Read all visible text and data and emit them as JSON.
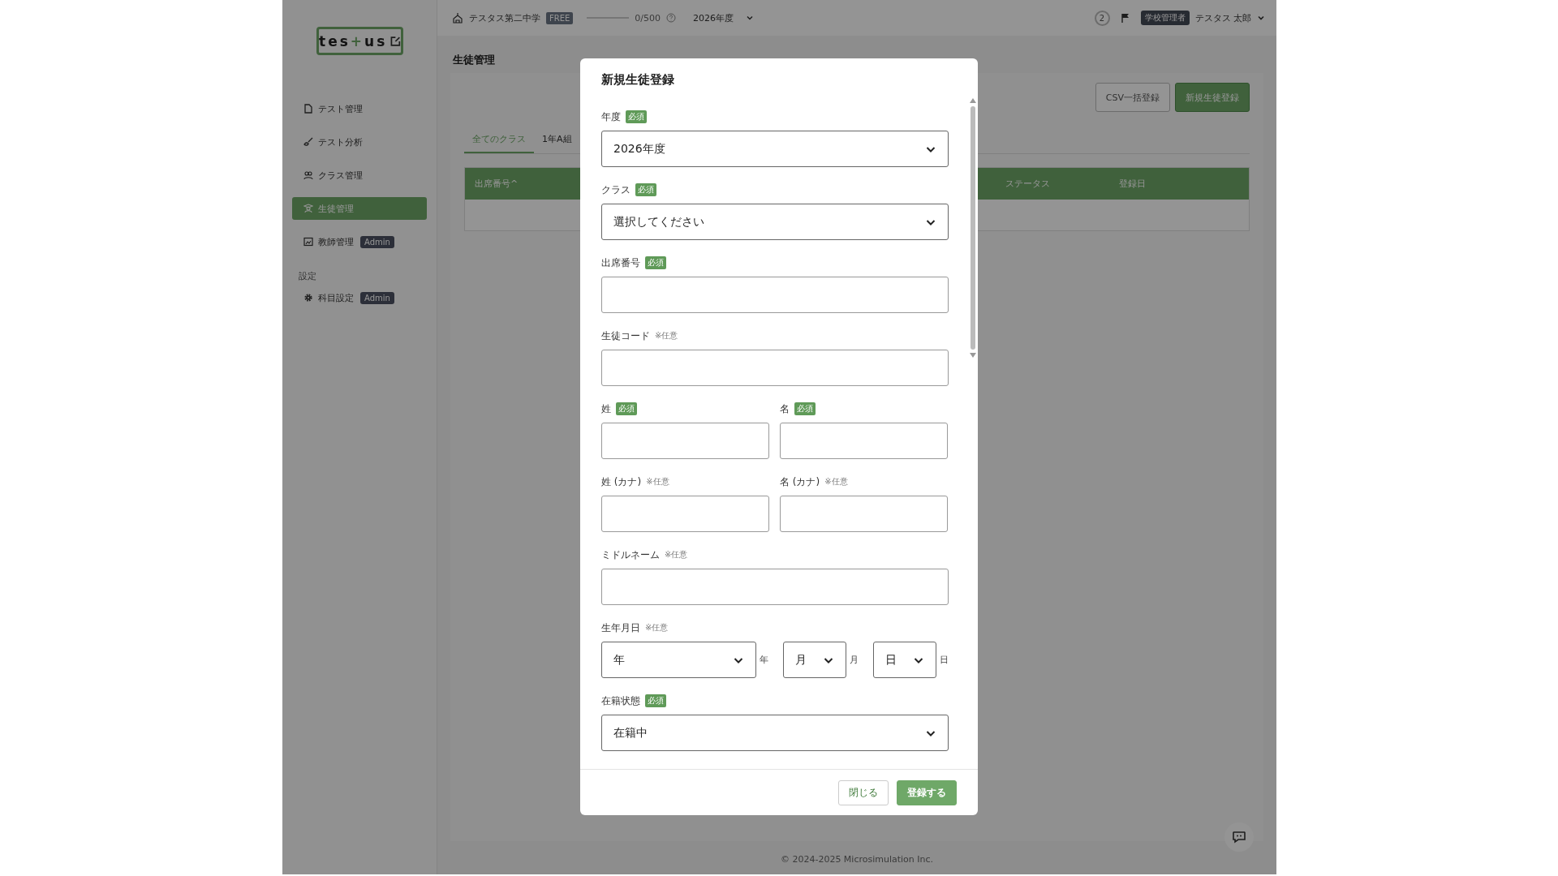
{
  "sidebar": {
    "logo": {
      "before": "tes",
      "mark": "+",
      "after": "us"
    },
    "items": [
      {
        "label": "テスト管理",
        "kind": "document",
        "selected": false
      },
      {
        "label": "テスト分析",
        "kind": "brush",
        "selected": false
      },
      {
        "label": "クラス管理",
        "kind": "people",
        "selected": false
      },
      {
        "label": "生徒管理",
        "kind": "student",
        "selected": true
      },
      {
        "label": "教師管理",
        "kind": "board",
        "selected": false,
        "badge": "Admin"
      }
    ],
    "section": "設定",
    "section_items": [
      {
        "label": "科目設定",
        "kind": "gear",
        "selected": false,
        "badge": "Admin"
      }
    ]
  },
  "header": {
    "school": "テスタス第二中学",
    "plan": "FREE",
    "usage": {
      "level": 0,
      "reading": "0/500"
    },
    "year": "2026年度",
    "notifications": "2",
    "role": "学校管理者",
    "user": "テスタス 太郎"
  },
  "main": {
    "title": "生徒管理",
    "buttons": [
      {
        "label": "CSV一括登録",
        "kind": "secondary"
      },
      {
        "label": "新規生徒登録",
        "kind": "primary"
      }
    ],
    "tabs": [
      {
        "label": "全てのクラス",
        "selected": true
      },
      {
        "label": "1年A組",
        "selected": false
      }
    ],
    "table": {
      "columns": [
        {
          "label": "出席番号",
          "sort": "^"
        },
        {
          "label": "ステータス"
        },
        {
          "label": "登録日"
        }
      ]
    }
  },
  "modal": {
    "title": "新規生徒登録",
    "fields": [
      {
        "kind": "select",
        "label": "年度",
        "required": true,
        "tag": "必須",
        "value": "2026年度"
      },
      {
        "kind": "select",
        "label": "クラス",
        "required": true,
        "tag": "必須",
        "value": "選択してください"
      },
      {
        "kind": "input",
        "label": "出席番号",
        "required": true,
        "tag": "必須"
      },
      {
        "kind": "input",
        "label": "生徒コード",
        "required": false,
        "tag": "※任意"
      },
      {
        "kind": "pair",
        "items": [
          {
            "label": "姓",
            "required": true,
            "tag": "必須"
          },
          {
            "label": "名",
            "required": true,
            "tag": "必須"
          }
        ]
      },
      {
        "kind": "pair",
        "items": [
          {
            "label": "姓 (カナ)",
            "required": false,
            "tag": "※任意"
          },
          {
            "label": "名 (カナ)",
            "required": false,
            "tag": "※任意"
          }
        ]
      },
      {
        "kind": "input",
        "label": "ミドルネーム",
        "required": false,
        "tag": "※任意"
      },
      {
        "kind": "date",
        "label": "生年月日",
        "required": false,
        "tag": "※任意",
        "parts": [
          {
            "value": "年",
            "unit": "年"
          },
          {
            "value": "月",
            "unit": "月"
          },
          {
            "value": "日",
            "unit": "日"
          }
        ]
      },
      {
        "kind": "select",
        "label": "在籍状態",
        "required": true,
        "tag": "必須",
        "value": "在籍中"
      }
    ],
    "buttons": [
      {
        "label": "閉じる",
        "kind": "secondary"
      },
      {
        "label": "登録する",
        "kind": "primary"
      }
    ]
  },
  "footer": "© 2024-2025 Microsimulation Inc."
}
